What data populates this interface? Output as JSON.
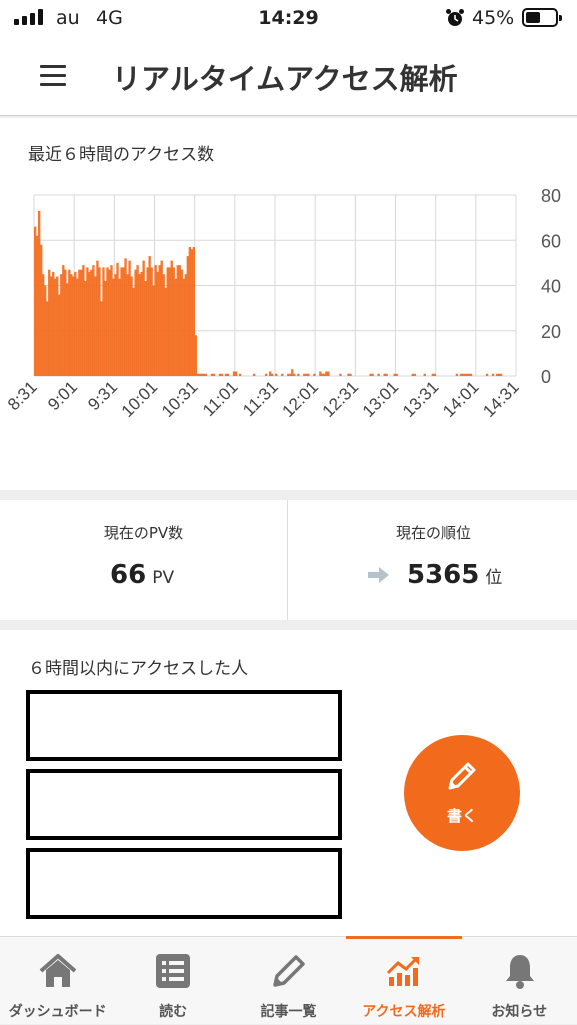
{
  "status_bar": {
    "carrier": "au",
    "network": "4G",
    "time": "14:29",
    "battery_pct": "45%"
  },
  "header": {
    "title": "リアルタイムアクセス解析"
  },
  "chart_section": {
    "title": "最近６時間のアクセス数"
  },
  "chart_data": {
    "type": "bar",
    "title": "最近６時間のアクセス数",
    "x_tick_labels": [
      "8:31",
      "9:01",
      "9:31",
      "10:01",
      "10:31",
      "11:01",
      "11:31",
      "12:01",
      "12:31",
      "13:01",
      "13:31",
      "14:01",
      "14:31"
    ],
    "y_tick_labels": [
      "0",
      "20",
      "40",
      "60",
      "80"
    ],
    "ylim": [
      0,
      80
    ],
    "grid": true,
    "y_axis_side": "right",
    "color": "#f26b1d",
    "values": [
      66,
      62,
      73,
      58,
      45,
      40,
      33,
      47,
      44,
      46,
      43,
      44,
      36,
      45,
      49,
      47,
      41,
      47,
      45,
      44,
      46,
      43,
      47,
      47,
      49,
      42,
      48,
      46,
      47,
      49,
      44,
      51,
      48,
      33,
      48,
      42,
      48,
      47,
      49,
      43,
      45,
      50,
      43,
      48,
      48,
      52,
      45,
      51,
      44,
      39,
      47,
      49,
      45,
      46,
      51,
      42,
      48,
      53,
      48,
      40,
      49,
      46,
      49,
      51,
      45,
      39,
      48,
      48,
      51,
      48,
      43,
      49,
      49,
      47,
      43,
      45,
      53,
      57,
      56,
      57,
      18,
      1,
      1,
      1,
      1,
      1,
      0,
      0,
      1,
      1,
      0,
      0,
      1,
      1,
      0,
      1,
      1,
      0,
      0,
      2,
      2,
      0,
      1,
      0,
      0,
      0,
      0,
      0,
      0,
      1,
      0,
      0,
      0,
      0,
      0,
      1,
      0,
      2,
      1,
      0,
      1,
      0,
      0,
      1,
      0,
      0,
      1,
      1,
      3,
      1,
      0,
      1,
      0,
      0,
      1,
      1,
      1,
      0,
      0,
      1,
      0,
      0,
      2,
      1,
      1,
      2,
      2,
      0,
      0,
      0,
      0,
      0,
      1,
      0,
      0,
      0,
      1,
      1,
      0,
      0,
      0,
      0,
      0,
      0,
      0,
      0,
      0,
      1,
      1,
      0,
      0,
      1,
      0,
      0,
      1,
      1,
      0,
      0,
      0,
      1,
      1,
      0,
      0,
      0,
      0,
      0,
      0,
      0,
      1,
      1,
      0,
      0,
      0,
      0,
      1,
      0,
      0,
      0,
      1,
      1,
      0,
      0,
      0,
      0,
      0,
      0,
      0,
      0,
      0,
      0,
      1,
      0,
      1,
      1,
      1,
      1,
      1,
      1,
      0,
      0,
      0,
      0,
      0,
      0,
      0,
      1,
      0,
      0,
      1,
      0,
      1,
      1,
      1,
      0,
      0,
      0,
      0,
      0,
      0,
      0
    ]
  },
  "stats": {
    "pv": {
      "label": "現在のPV数",
      "value": "66",
      "unit": "PV"
    },
    "rank": {
      "label": "現在の順位",
      "value": "5365",
      "unit": "位",
      "trend": "arrow-right-icon"
    }
  },
  "visitors": {
    "title": "６時間以内にアクセスした人"
  },
  "write_button": {
    "label": "書く",
    "icon": "pencil-icon"
  },
  "tabs": [
    {
      "label": "ダッシュボード",
      "icon": "home-icon"
    },
    {
      "label": "読む",
      "icon": "list-icon"
    },
    {
      "label": "記事一覧",
      "icon": "pencil-icon"
    },
    {
      "label": "アクセス解析",
      "icon": "analytics-icon",
      "active": true
    },
    {
      "label": "お知らせ",
      "icon": "bell-icon"
    }
  ],
  "colors": {
    "accent": "#f26b1d",
    "grid": "#d8d8d8"
  }
}
